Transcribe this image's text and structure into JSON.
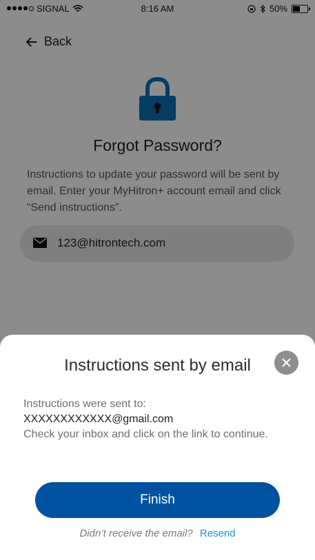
{
  "status_bar": {
    "carrier": "SIGNAL",
    "time": "8:16 AM",
    "battery": "50%",
    "battery_level": 0.5
  },
  "header": {
    "back_label": "Back"
  },
  "page": {
    "title": "Forgot Password?",
    "description": "Instructions to update your password will be sent by email. Enter your MyHitron+ account email and click “Send instructions”.",
    "email_value": "123@hitrontech.com"
  },
  "sheet": {
    "title": "Instructions sent by email",
    "sent_to_label": "Instructions were sent to:",
    "address": "XXXXXXXXXXXX@gmail.com",
    "instruction": "Check your inbox and click on the link to continue.",
    "finish_label": "Finish",
    "no_email_question": "Didn’t receive the email?",
    "resend_label": "Resend"
  },
  "colors": {
    "primary": "#0052a0",
    "link": "#1a8fd6",
    "lock": "#0a6fb5"
  }
}
